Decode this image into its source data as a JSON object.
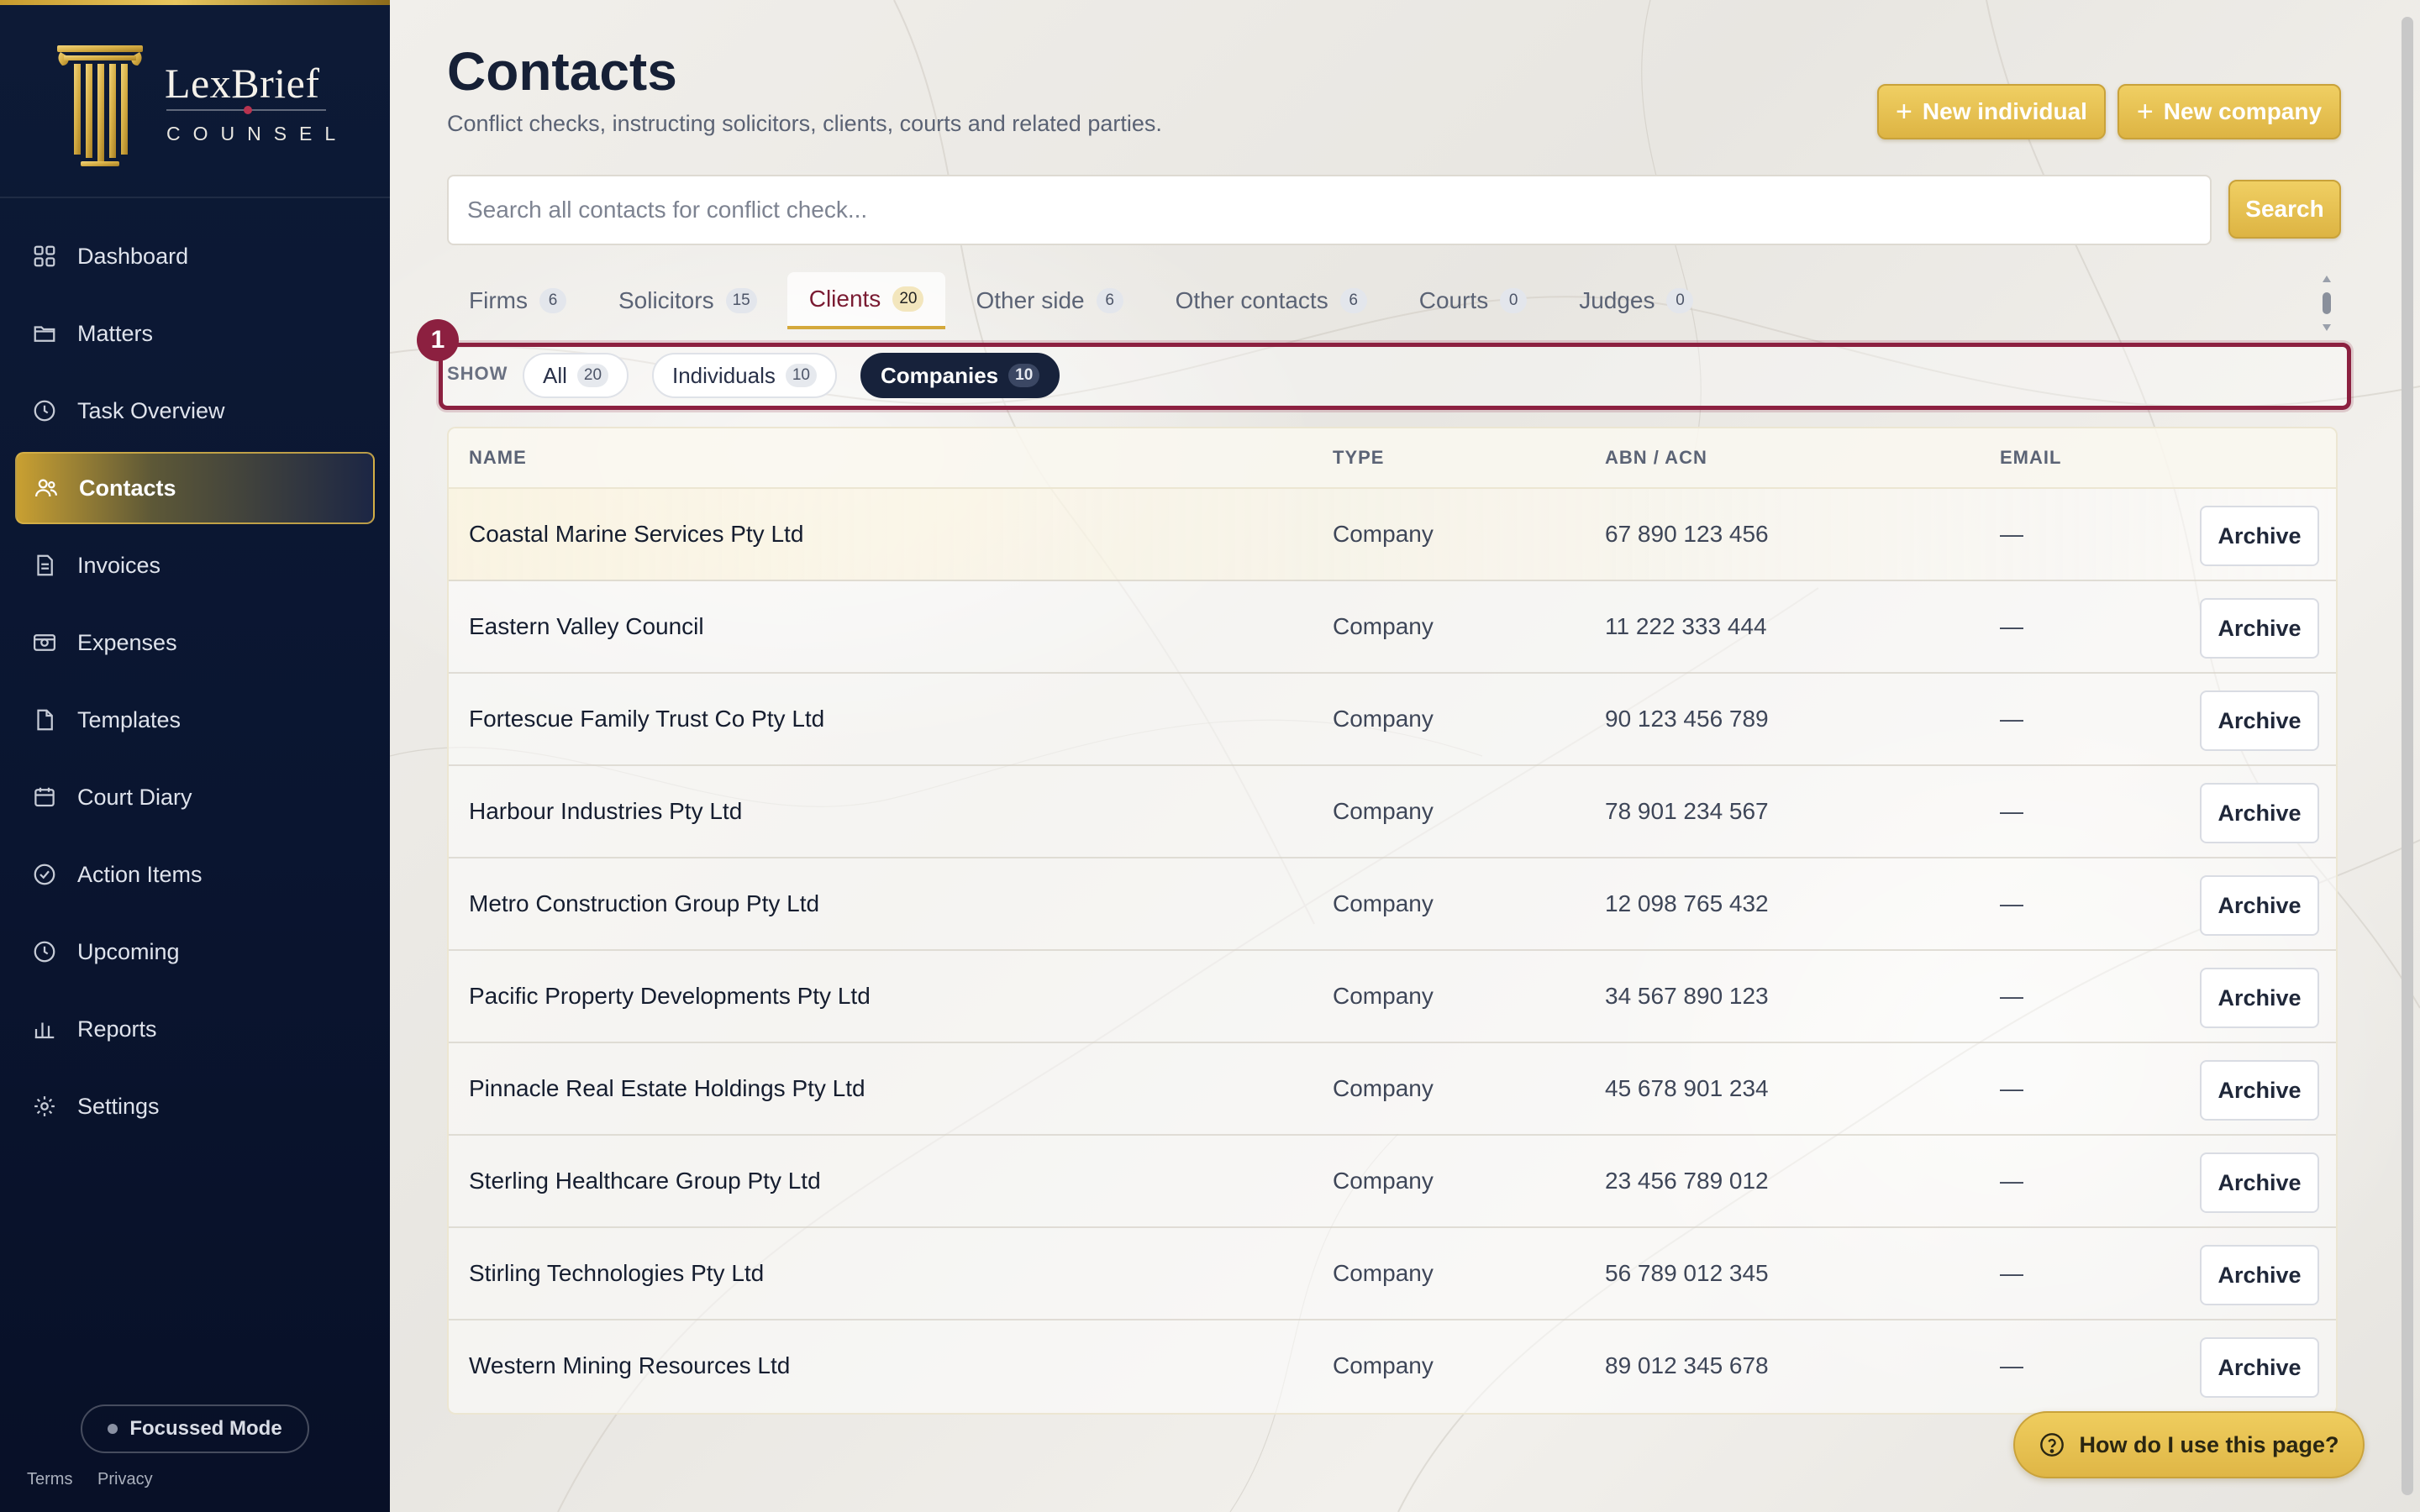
{
  "brand": {
    "name": "LexBrief",
    "sub": "COUNSEL"
  },
  "sidebar": {
    "items": [
      {
        "label": "Dashboard",
        "icon": "grid-icon"
      },
      {
        "label": "Matters",
        "icon": "folder-icon"
      },
      {
        "label": "Task Overview",
        "icon": "clock-icon"
      },
      {
        "label": "Contacts",
        "icon": "users-icon",
        "active": true
      },
      {
        "label": "Invoices",
        "icon": "invoice-icon"
      },
      {
        "label": "Expenses",
        "icon": "cash-icon"
      },
      {
        "label": "Templates",
        "icon": "file-icon"
      },
      {
        "label": "Court Diary",
        "icon": "calendar-icon"
      },
      {
        "label": "Action Items",
        "icon": "check-circle-icon"
      },
      {
        "label": "Upcoming",
        "icon": "clock-icon"
      },
      {
        "label": "Reports",
        "icon": "bar-chart-icon"
      },
      {
        "label": "Settings",
        "icon": "gear-icon"
      }
    ],
    "focus_mode": "Focussed Mode",
    "terms": "Terms",
    "privacy": "Privacy"
  },
  "header": {
    "title": "Contacts",
    "subtitle": "Conflict checks, instructing solicitors, clients, courts and related parties.",
    "new_individual": "New individual",
    "new_company": "New company"
  },
  "search": {
    "placeholder": "Search all contacts for conflict check...",
    "value": "",
    "button": "Search"
  },
  "tabs": [
    {
      "label": "Firms",
      "count": "6"
    },
    {
      "label": "Solicitors",
      "count": "15"
    },
    {
      "label": "Clients",
      "count": "20",
      "active": true
    },
    {
      "label": "Other side",
      "count": "6"
    },
    {
      "label": "Other contacts",
      "count": "6"
    },
    {
      "label": "Courts",
      "count": "0"
    },
    {
      "label": "Judges",
      "count": "0"
    }
  ],
  "filter": {
    "marker": "1",
    "show_label": "SHOW",
    "options": [
      {
        "label": "All",
        "count": "20"
      },
      {
        "label": "Individuals",
        "count": "10"
      },
      {
        "label": "Companies",
        "count": "10",
        "active": true
      }
    ]
  },
  "table": {
    "columns": [
      "NAME",
      "TYPE",
      "ABN / ACN",
      "EMAIL"
    ],
    "archive_label": "Archive",
    "rows": [
      {
        "name": "Coastal Marine Services Pty Ltd",
        "type": "Company",
        "abn": "67 890 123 456",
        "email": "—"
      },
      {
        "name": "Eastern Valley Council",
        "type": "Company",
        "abn": "11 222 333 444",
        "email": "—"
      },
      {
        "name": "Fortescue Family Trust Co Pty Ltd",
        "type": "Company",
        "abn": "90 123 456 789",
        "email": "—"
      },
      {
        "name": "Harbour Industries Pty Ltd",
        "type": "Company",
        "abn": "78 901 234 567",
        "email": "—"
      },
      {
        "name": "Metro Construction Group Pty Ltd",
        "type": "Company",
        "abn": "12 098 765 432",
        "email": "—"
      },
      {
        "name": "Pacific Property Developments Pty Ltd",
        "type": "Company",
        "abn": "34 567 890 123",
        "email": "—"
      },
      {
        "name": "Pinnacle Real Estate Holdings Pty Ltd",
        "type": "Company",
        "abn": "45 678 901 234",
        "email": "—"
      },
      {
        "name": "Sterling Healthcare Group Pty Ltd",
        "type": "Company",
        "abn": "23 456 789 012",
        "email": "—"
      },
      {
        "name": "Stirling Technologies Pty Ltd",
        "type": "Company",
        "abn": "56 789 012 345",
        "email": "—"
      },
      {
        "name": "Western Mining Resources Ltd",
        "type": "Company",
        "abn": "89 012 345 678",
        "email": "—"
      }
    ]
  },
  "help": {
    "label": "How do I use this page?"
  },
  "colors": {
    "navy": "#0d1a36",
    "gold": "#ddb443",
    "accent": "#8c2040"
  }
}
